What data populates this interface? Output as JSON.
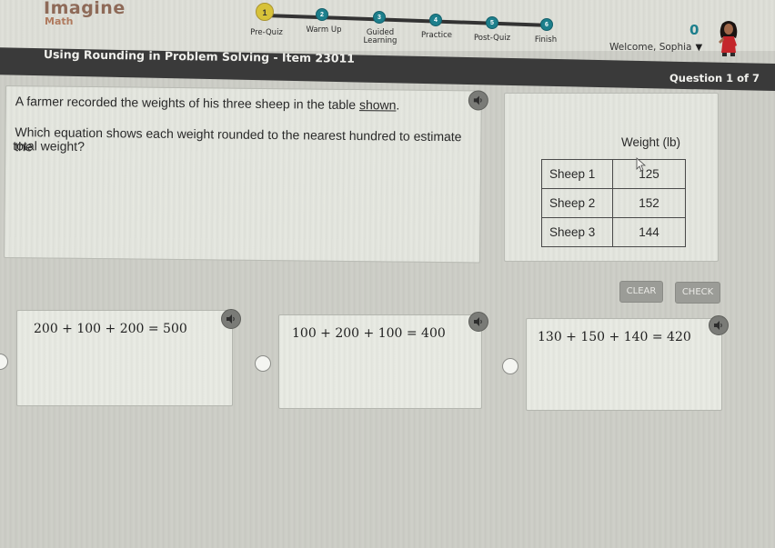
{
  "app": {
    "name": "Imagine",
    "subtitle": "Math"
  },
  "progress": {
    "steps": [
      {
        "number": "1",
        "label": "Pre-Quiz",
        "current": true
      },
      {
        "number": "2",
        "label": "Warm Up",
        "current": false
      },
      {
        "number": "3",
        "label": "Guided Learning",
        "label_line1": "Guided",
        "label_line2": "Learning",
        "current": false
      },
      {
        "number": "4",
        "label": "Practice",
        "current": false
      },
      {
        "number": "5",
        "label": "Post-Quiz",
        "current": false
      },
      {
        "number": "6",
        "label": "Finish",
        "current": false
      }
    ]
  },
  "user": {
    "points": "0",
    "welcome": "Welcome, Sophia",
    "menu_caret": "▼",
    "avatar_icon": "character-avatar"
  },
  "lesson": {
    "title": "Using Rounding in Problem Solving - Item 23011",
    "question_counter": "Question 1 of 7"
  },
  "question": {
    "line1_prefix": "A farmer recorded the weights of his three sheep in the table ",
    "line1_link": "shown",
    "line1_suffix": ".",
    "line2": "Which equation shows each weight rounded to the nearest hundred to estimate the",
    "line3": "total weight?"
  },
  "table": {
    "header": "Weight (lb)",
    "rows": [
      {
        "name": "Sheep 1",
        "weight": "125"
      },
      {
        "name": "Sheep 2",
        "weight": "152"
      },
      {
        "name": "Sheep 3",
        "weight": "144"
      }
    ]
  },
  "buttons": {
    "clear": "CLEAR",
    "check": "CHECK"
  },
  "choices": [
    {
      "equation": "200 + 100 + 200 = 500"
    },
    {
      "equation": "100 + 200 + 100 = 400"
    },
    {
      "equation": "130 + 150 + 140 = 420"
    }
  ],
  "colors": {
    "accent_teal": "#1d7f8c",
    "current_step": "#d7c239",
    "title_bar": "#3a3a3a",
    "logo": "#8e6a58"
  }
}
